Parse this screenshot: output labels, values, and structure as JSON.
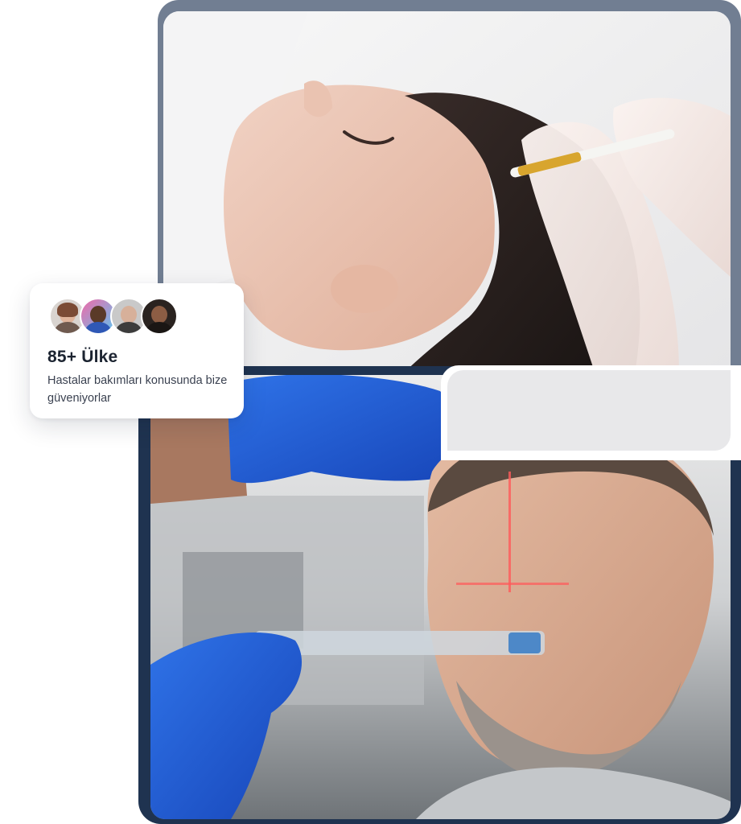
{
  "stats_card": {
    "title": "85+ Ülke",
    "subtitle": "Hastalar bakımları konusunda bize güveniyorlar",
    "avatars": [
      "avatar-woman",
      "avatar-man-colorful",
      "avatar-man-bald",
      "avatar-man-dark"
    ]
  },
  "photos": {
    "top": "scalp-injection-photo",
    "bottom": "laser-hair-measurement-photo"
  },
  "colors": {
    "top_frame": "#717e92",
    "bottom_frame": "#1f3350",
    "glove_blue": "#1f5fd6",
    "title_text": "#1c2431"
  }
}
